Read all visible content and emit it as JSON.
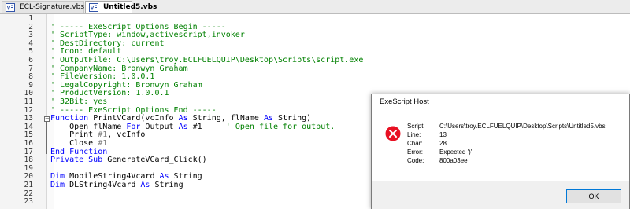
{
  "tabs": [
    {
      "label": "ECL-Signature.vbs",
      "active": false
    },
    {
      "label": "Untitled5.vbs",
      "active": true
    }
  ],
  "editor": {
    "line_numbers": [
      "1",
      "2",
      "3",
      "4",
      "5",
      "6",
      "7",
      "8",
      "9",
      "10",
      "11",
      "12",
      "13",
      "14",
      "15",
      "16",
      "17",
      "18",
      "19",
      "20",
      "21",
      "22",
      "23"
    ],
    "lines": [
      [],
      [
        {
          "t": "' ----- ExeScript Options Begin -----",
          "c": "c"
        }
      ],
      [
        {
          "t": "' ScriptType: window,activescript,invoker",
          "c": "c"
        }
      ],
      [
        {
          "t": "' DestDirectory: current",
          "c": "c"
        }
      ],
      [
        {
          "t": "' Icon: default",
          "c": "c"
        }
      ],
      [
        {
          "t": "' OutputFile: C:\\Users\\troy.ECLFUELQUIP\\Desktop\\Scripts\\script.exe",
          "c": "c"
        }
      ],
      [
        {
          "t": "' CompanyName: Bronwyn Graham",
          "c": "c"
        }
      ],
      [
        {
          "t": "' FileVersion: 1.0.0.1",
          "c": "c"
        }
      ],
      [
        {
          "t": "' LegalCopyright: Bronwyn Graham",
          "c": "c"
        }
      ],
      [
        {
          "t": "' ProductVersion: 1.0.0.1",
          "c": "c"
        }
      ],
      [
        {
          "t": "' 32Bit: yes",
          "c": "c"
        }
      ],
      [
        {
          "t": "' ----- ExeScript Options End -----",
          "c": "c"
        }
      ],
      [
        {
          "t": "Function ",
          "c": "k"
        },
        {
          "t": "PrintVCard(vcInfo ",
          "c": "n"
        },
        {
          "t": "As ",
          "c": "k"
        },
        {
          "t": "String, flName ",
          "c": "n"
        },
        {
          "t": "As ",
          "c": "k"
        },
        {
          "t": "String)",
          "c": "n"
        }
      ],
      [
        {
          "t": "    Open flName ",
          "c": "n"
        },
        {
          "t": "For ",
          "c": "k"
        },
        {
          "t": "Output ",
          "c": "n"
        },
        {
          "t": "As ",
          "c": "k"
        },
        {
          "t": "#1     ",
          "c": "n"
        },
        {
          "t": "' Open file for output.",
          "c": "c"
        }
      ],
      [
        {
          "t": "    Print ",
          "c": "n"
        },
        {
          "t": "#1",
          "c": "s"
        },
        {
          "t": ", vcInfo",
          "c": "n"
        }
      ],
      [
        {
          "t": "    Close ",
          "c": "n"
        },
        {
          "t": "#1",
          "c": "s"
        }
      ],
      [
        {
          "t": "End Function",
          "c": "k"
        }
      ],
      [
        {
          "t": "Private Sub ",
          "c": "k"
        },
        {
          "t": "GenerateVCard_Click()",
          "c": "n"
        }
      ],
      [],
      [
        {
          "t": "Dim ",
          "c": "k"
        },
        {
          "t": "MobileString4Vcard ",
          "c": "n"
        },
        {
          "t": "As ",
          "c": "k"
        },
        {
          "t": "String",
          "c": "n"
        }
      ],
      [
        {
          "t": "Dim ",
          "c": "k"
        },
        {
          "t": "DLString4Vcard ",
          "c": "n"
        },
        {
          "t": "As ",
          "c": "k"
        },
        {
          "t": "String",
          "c": "n"
        }
      ],
      [],
      []
    ]
  },
  "dialog": {
    "title": "ExeScript Host",
    "fields": [
      {
        "label": "Script:",
        "value": "C:\\Users\\troy.ECLFUELQUIP\\Desktop\\Scripts\\Untitled5.vbs"
      },
      {
        "label": "Line:",
        "value": "13"
      },
      {
        "label": "Char:",
        "value": "28"
      },
      {
        "label": "Error:",
        "value": "Expected ')'"
      },
      {
        "label": "Code:",
        "value": "800a03ee"
      }
    ],
    "ok_label": "OK",
    "icon": "error-icon"
  }
}
